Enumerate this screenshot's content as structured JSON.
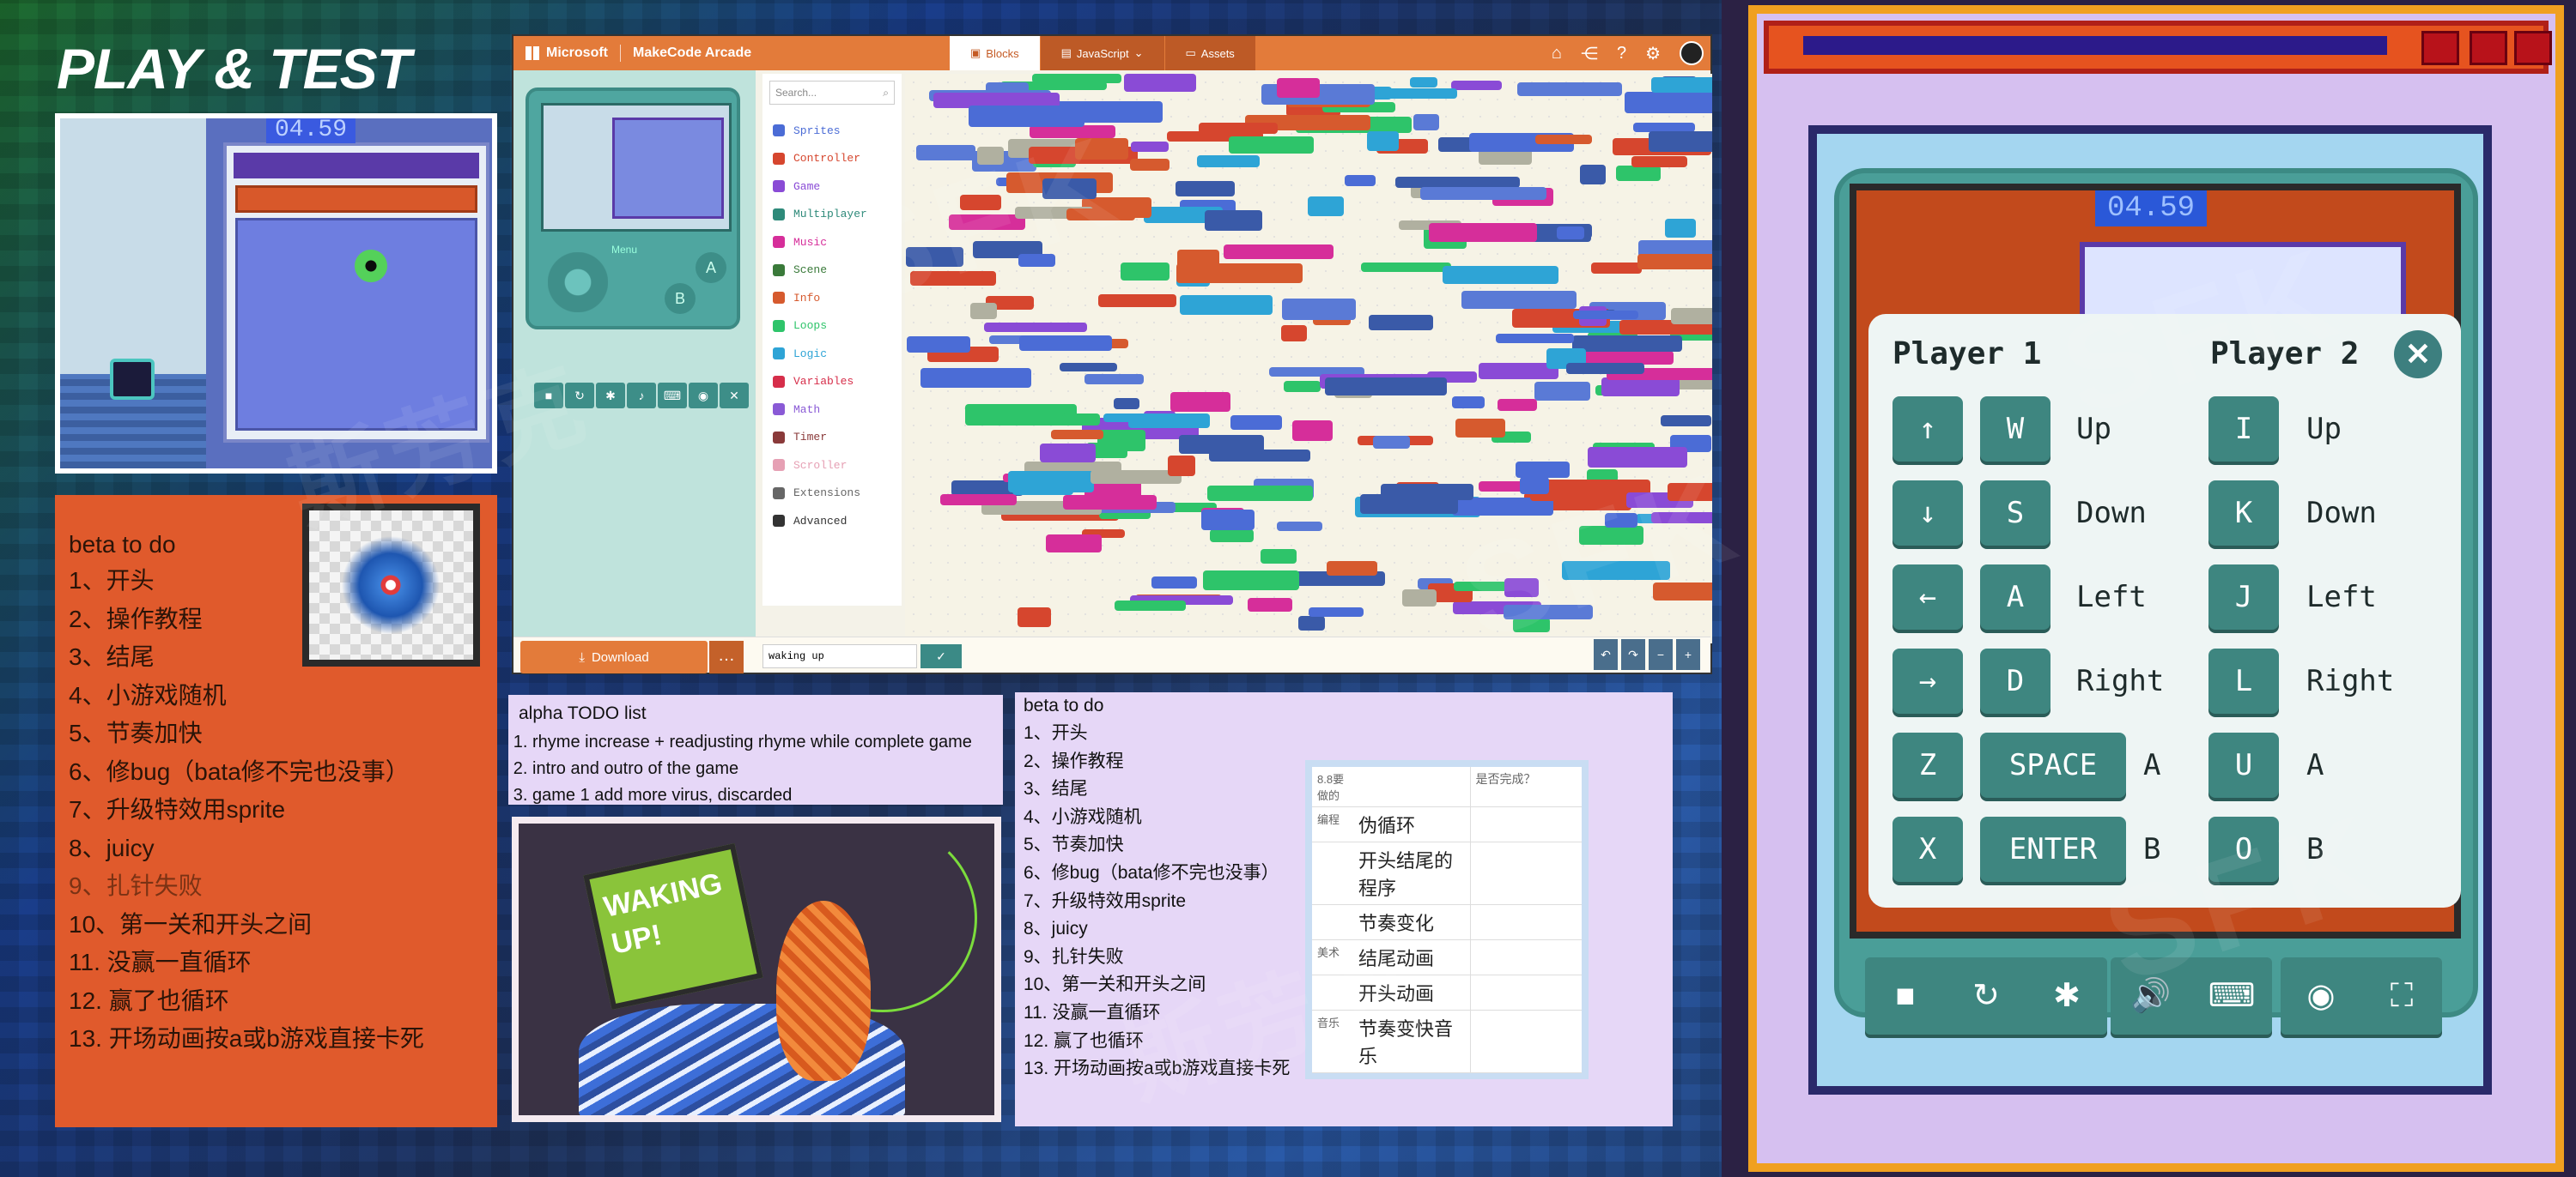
{
  "title": "PLAY & TEST",
  "preview_left": {
    "timer": "04.59"
  },
  "beta_left": {
    "heading": "beta to do",
    "items": [
      "1、开头",
      "2、操作教程",
      "3、结尾",
      "4、小游戏随机",
      "5、节奏加快",
      "6、修bug（bata修不完也没事）",
      "7、升级特效用sprite",
      "8、juicy",
      "9、扎针失败",
      "10、第一关和开头之间",
      "11. 没赢一直循环",
      "12. 赢了也循环",
      "13. 开场动画按a或b游戏直接卡死"
    ]
  },
  "makecode": {
    "brand": "Microsoft",
    "app": "MakeCode Arcade",
    "tabs": [
      "Blocks",
      "JavaScript",
      "Assets"
    ],
    "search_placeholder": "Search...",
    "categories": [
      {
        "label": "Sprites",
        "color": "#4b6cd6"
      },
      {
        "label": "Controller",
        "color": "#d6462e"
      },
      {
        "label": "Game",
        "color": "#8a4bd6"
      },
      {
        "label": "Multiplayer",
        "color": "#2e8a7a"
      },
      {
        "label": "Music",
        "color": "#d62e9a"
      },
      {
        "label": "Scene",
        "color": "#3a7a3a"
      },
      {
        "label": "Info",
        "color": "#d65a2e"
      },
      {
        "label": "Loops",
        "color": "#2ec46a"
      },
      {
        "label": "Logic",
        "color": "#2ea4d6"
      },
      {
        "label": "Variables",
        "color": "#d62e4a"
      },
      {
        "label": "Math",
        "color": "#8a5ad6"
      },
      {
        "label": "Timer",
        "color": "#8a3a3a"
      },
      {
        "label": "Scroller",
        "color": "#e6a0b4"
      },
      {
        "label": "Extensions",
        "color": "#666666"
      },
      {
        "label": "Advanced",
        "color": "#333333"
      }
    ],
    "sim_menu": "Menu",
    "btn_a": "A",
    "btn_b": "B",
    "download": "Download",
    "project_name": "waking up"
  },
  "alpha": {
    "heading": "alpha TODO list",
    "items": [
      "rhyme increase + readjusting rhyme while complete game",
      "intro and outro of the game",
      "game 1 add more virus, discarded"
    ]
  },
  "waking_art": {
    "sign_line1": "WAKING",
    "sign_line2": "UP!"
  },
  "beta_right": {
    "heading": "beta to do",
    "items": [
      "1、开头",
      "2、操作教程",
      "3、结尾",
      "4、小游戏随机",
      "5、节奏加快",
      "6、修bug（bata修不完也没事）",
      "7、升级特效用sprite",
      "8、juicy",
      "9、扎针失败",
      "10、第一关和开头之间",
      "11. 没赢一直循环",
      "12. 赢了也循环",
      "13. 开场动画按a或b游戏直接卡死"
    ]
  },
  "task_table": {
    "header": [
      "8.8要做的",
      "",
      "是否完成？"
    ],
    "rows": [
      {
        "group": "编程",
        "task": "伪循环"
      },
      {
        "group": "",
        "task": "开头结尾的程序"
      },
      {
        "group": "",
        "task": "节奏变化"
      },
      {
        "group": "美术",
        "task": "结尾动画"
      },
      {
        "group": "",
        "task": "开头动画"
      },
      {
        "group": "音乐",
        "task": "节奏变快音乐"
      }
    ]
  },
  "key_dialog": {
    "player1": "Player 1",
    "player2": "Player 2",
    "timer": "04.59",
    "rows": [
      {
        "p1_keys": [
          "↑",
          "W"
        ],
        "p1_label": "Up",
        "p2_keys": [
          "I"
        ],
        "p2_label": "Up"
      },
      {
        "p1_keys": [
          "↓",
          "S"
        ],
        "p1_label": "Down",
        "p2_keys": [
          "K"
        ],
        "p2_label": "Down"
      },
      {
        "p1_keys": [
          "←",
          "A"
        ],
        "p1_label": "Left",
        "p2_keys": [
          "J"
        ],
        "p2_label": "Left"
      },
      {
        "p1_keys": [
          "→",
          "D"
        ],
        "p1_label": "Right",
        "p2_keys": [
          "L"
        ],
        "p2_label": "Right"
      },
      {
        "p1_keys": [
          "Z",
          "SPACE"
        ],
        "p1_label": "A",
        "p2_keys": [
          "U"
        ],
        "p2_label": "A"
      },
      {
        "p1_keys": [
          "X",
          "ENTER"
        ],
        "p1_label": "B",
        "p2_keys": [
          "O"
        ],
        "p2_label": "B"
      }
    ]
  },
  "colors": {
    "orange_panel": "#e05a2c",
    "lavender": "#e6d7f7",
    "teal": "#3e8680",
    "makecode_orange": "#e37b3a"
  },
  "watermarks": {
    "main": "SFK",
    "cn": "斯芳克",
    "sub": "INTERNATIONAL ART EDUCATION"
  }
}
